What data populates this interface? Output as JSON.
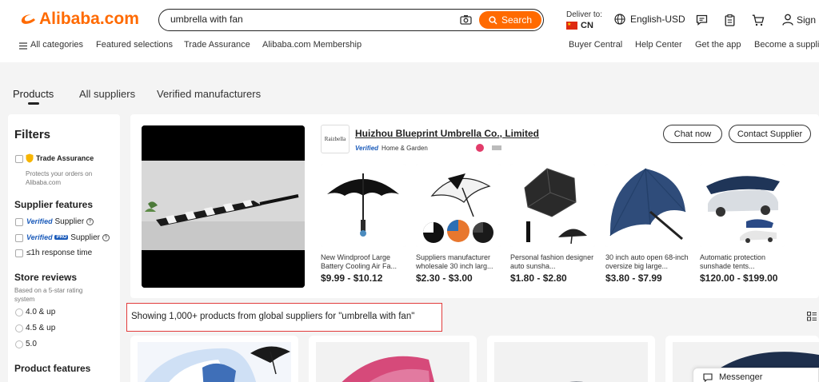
{
  "header": {
    "logo_text": "Alibaba.com",
    "search": {
      "value": "umbrella with fan",
      "button_label": "Search"
    },
    "deliver_to": {
      "label": "Deliver to:",
      "country": "CN"
    },
    "language": "English-USD",
    "signin": "Sign in"
  },
  "nav": {
    "left": [
      "All categories",
      "Featured selections",
      "Trade Assurance",
      "Alibaba.com Membership"
    ],
    "right": [
      "Buyer Central",
      "Help Center",
      "Get the app",
      "Become a supplier"
    ]
  },
  "tabs": [
    "Products",
    "All suppliers",
    "Verified manufacturers"
  ],
  "filters": {
    "title": "Filters",
    "trade_assurance": {
      "label": "Trade Assurance",
      "desc_1": "Protects your orders on",
      "desc_2": "Alibaba.com"
    },
    "supplier_features": {
      "title": "Supplier features",
      "verified": "Verified",
      "supplier": "Supplier",
      "pro": "PRO",
      "response": "≤1h response time"
    },
    "store_reviews": {
      "title": "Store reviews",
      "desc_1": "Based on a 5-star rating",
      "desc_2": "system",
      "options": [
        "4.0 & up",
        "4.5 & up",
        "5.0"
      ]
    },
    "product_features": {
      "title": "Product features"
    }
  },
  "supplier": {
    "logo_text": "Raizbella",
    "name": "Huizhou Blueprint Umbrella Co., Limited",
    "verified": "Verified",
    "category": "Home & Garden",
    "chat_button": "Chat now",
    "contact_button": "Contact Supplier",
    "products": [
      {
        "title": "New Windproof Large Battery Cooling Air Fa...",
        "price": "$9.99 - $10.12"
      },
      {
        "title": "Suppliers manufacturer wholesale 30 inch larg...",
        "price": "$2.30 - $3.00"
      },
      {
        "title": "Personal fashion designer auto sunsha...",
        "price": "$1.80 - $2.80"
      },
      {
        "title": "30 inch auto open 68-inch oversize big large...",
        "price": "$3.80 - $7.99"
      },
      {
        "title": "Automatic protection sunshade tents...",
        "price": "$120.00 - $199.00"
      }
    ]
  },
  "results": {
    "summary": "Showing 1,000+ products from global suppliers for \"umbrella with fan\""
  },
  "messenger": "Messenger",
  "colors": {
    "brand": "#ff6a00",
    "highlight_border": "#e23c3c",
    "verified_blue": "#1b5bba"
  }
}
